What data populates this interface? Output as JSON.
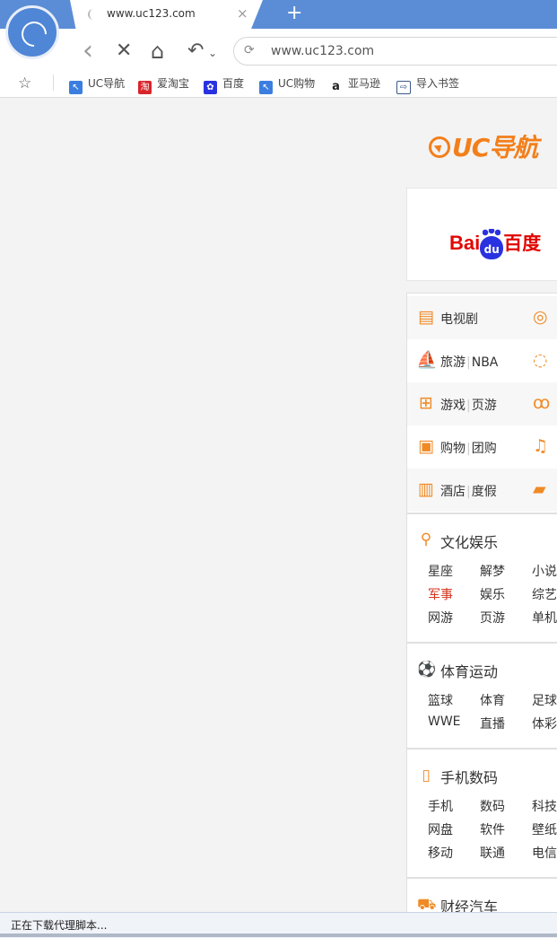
{
  "browser": {
    "tab": {
      "title": "www.uc123.com",
      "close": "×"
    },
    "new_tab": "+",
    "address": {
      "url": "www.uc123.com"
    },
    "nav": {
      "back": "‹",
      "stop": "✕",
      "home": "⌂",
      "undo": "↶",
      "undo_arrow": "⌄"
    },
    "bookmarks": [
      {
        "label": "UC导航",
        "icon": "uc-nav-icon",
        "color": "#3b7ee0",
        "glyph": "↖"
      },
      {
        "label": "爱淘宝",
        "icon": "taobao-icon",
        "color": "#d8252b",
        "glyph": "淘"
      },
      {
        "label": "百度",
        "icon": "baidu-icon",
        "color": "#2932e1",
        "glyph": "✿"
      },
      {
        "label": "UC购物",
        "icon": "uc-shopping-icon",
        "color": "#3b7ee0",
        "glyph": "↖"
      },
      {
        "label": "亚马逊",
        "icon": "amazon-icon",
        "color": "#ffffff",
        "glyph": "a"
      },
      {
        "label": "导入书签",
        "icon": "import-icon",
        "color": "#ffffff",
        "glyph": "⇨"
      }
    ]
  },
  "page": {
    "logo": "UC导航",
    "search": {
      "bai": "Bai",
      "du": "du",
      "baidu_cn": "百度"
    },
    "categories": [
      {
        "icon": "clapperboard-icon",
        "glyph": "🎬",
        "parts": [
          "电视剧"
        ],
        "right_icon": "film-reel-icon",
        "right_glyph": "◎"
      },
      {
        "icon": "sailboat-icon",
        "glyph": "⛵",
        "parts": [
          "旅游",
          "NBA"
        ],
        "right_icon": "chat-bubble-icon",
        "right_glyph": "💬"
      },
      {
        "icon": "gamepad-icon",
        "glyph": "🎮",
        "parts": [
          "游戏",
          "页游"
        ],
        "right_icon": "bra-icon",
        "right_glyph": "♒"
      },
      {
        "icon": "shopping-bag-icon",
        "glyph": "🛍",
        "parts": [
          "购物",
          "团购"
        ],
        "right_icon": "music-icon",
        "right_glyph": "♫"
      },
      {
        "icon": "hotel-icon",
        "glyph": "🏨",
        "parts": [
          "酒店",
          "度假"
        ],
        "right_icon": "train-icon",
        "right_glyph": "🚄"
      }
    ],
    "sections": {
      "culture": {
        "title": "文化娱乐",
        "links": [
          [
            "星座",
            "解梦",
            "小说"
          ],
          [
            "军事",
            "娱乐",
            "综艺"
          ],
          [
            "网游",
            "页游",
            "单机"
          ]
        ]
      },
      "sports": {
        "title": "体育运动",
        "links": [
          [
            "篮球",
            "体育",
            "足球"
          ],
          [
            "WWE",
            "直播",
            "体彩"
          ]
        ]
      },
      "digital": {
        "title": "手机数码",
        "links": [
          [
            "手机",
            "数码",
            "科技"
          ],
          [
            "网盘",
            "软件",
            "壁纸"
          ],
          [
            "移动",
            "联通",
            "电信"
          ]
        ]
      },
      "finance": {
        "title": "财经汽车"
      }
    }
  },
  "status": {
    "text": "正在下载代理脚本..."
  },
  "colors": {
    "accent": "#f37f1a",
    "chrome": "#5b8dd6",
    "link_red": "#d4341e"
  }
}
